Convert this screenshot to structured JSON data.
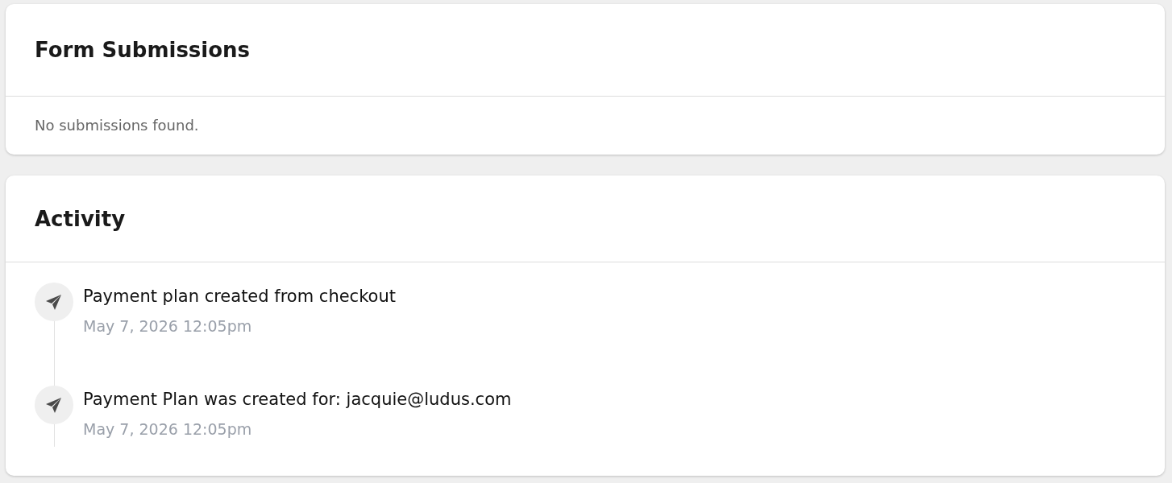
{
  "form_submissions": {
    "title": "Form Submissions",
    "empty_message": "No submissions found."
  },
  "activity": {
    "title": "Activity",
    "items": [
      {
        "text": "Payment plan created from checkout",
        "time": "May 7, 2026 12:05pm"
      },
      {
        "text": "Payment Plan was created for: jacquie@ludus.com",
        "time": "May 7, 2026 12:05pm"
      }
    ]
  }
}
